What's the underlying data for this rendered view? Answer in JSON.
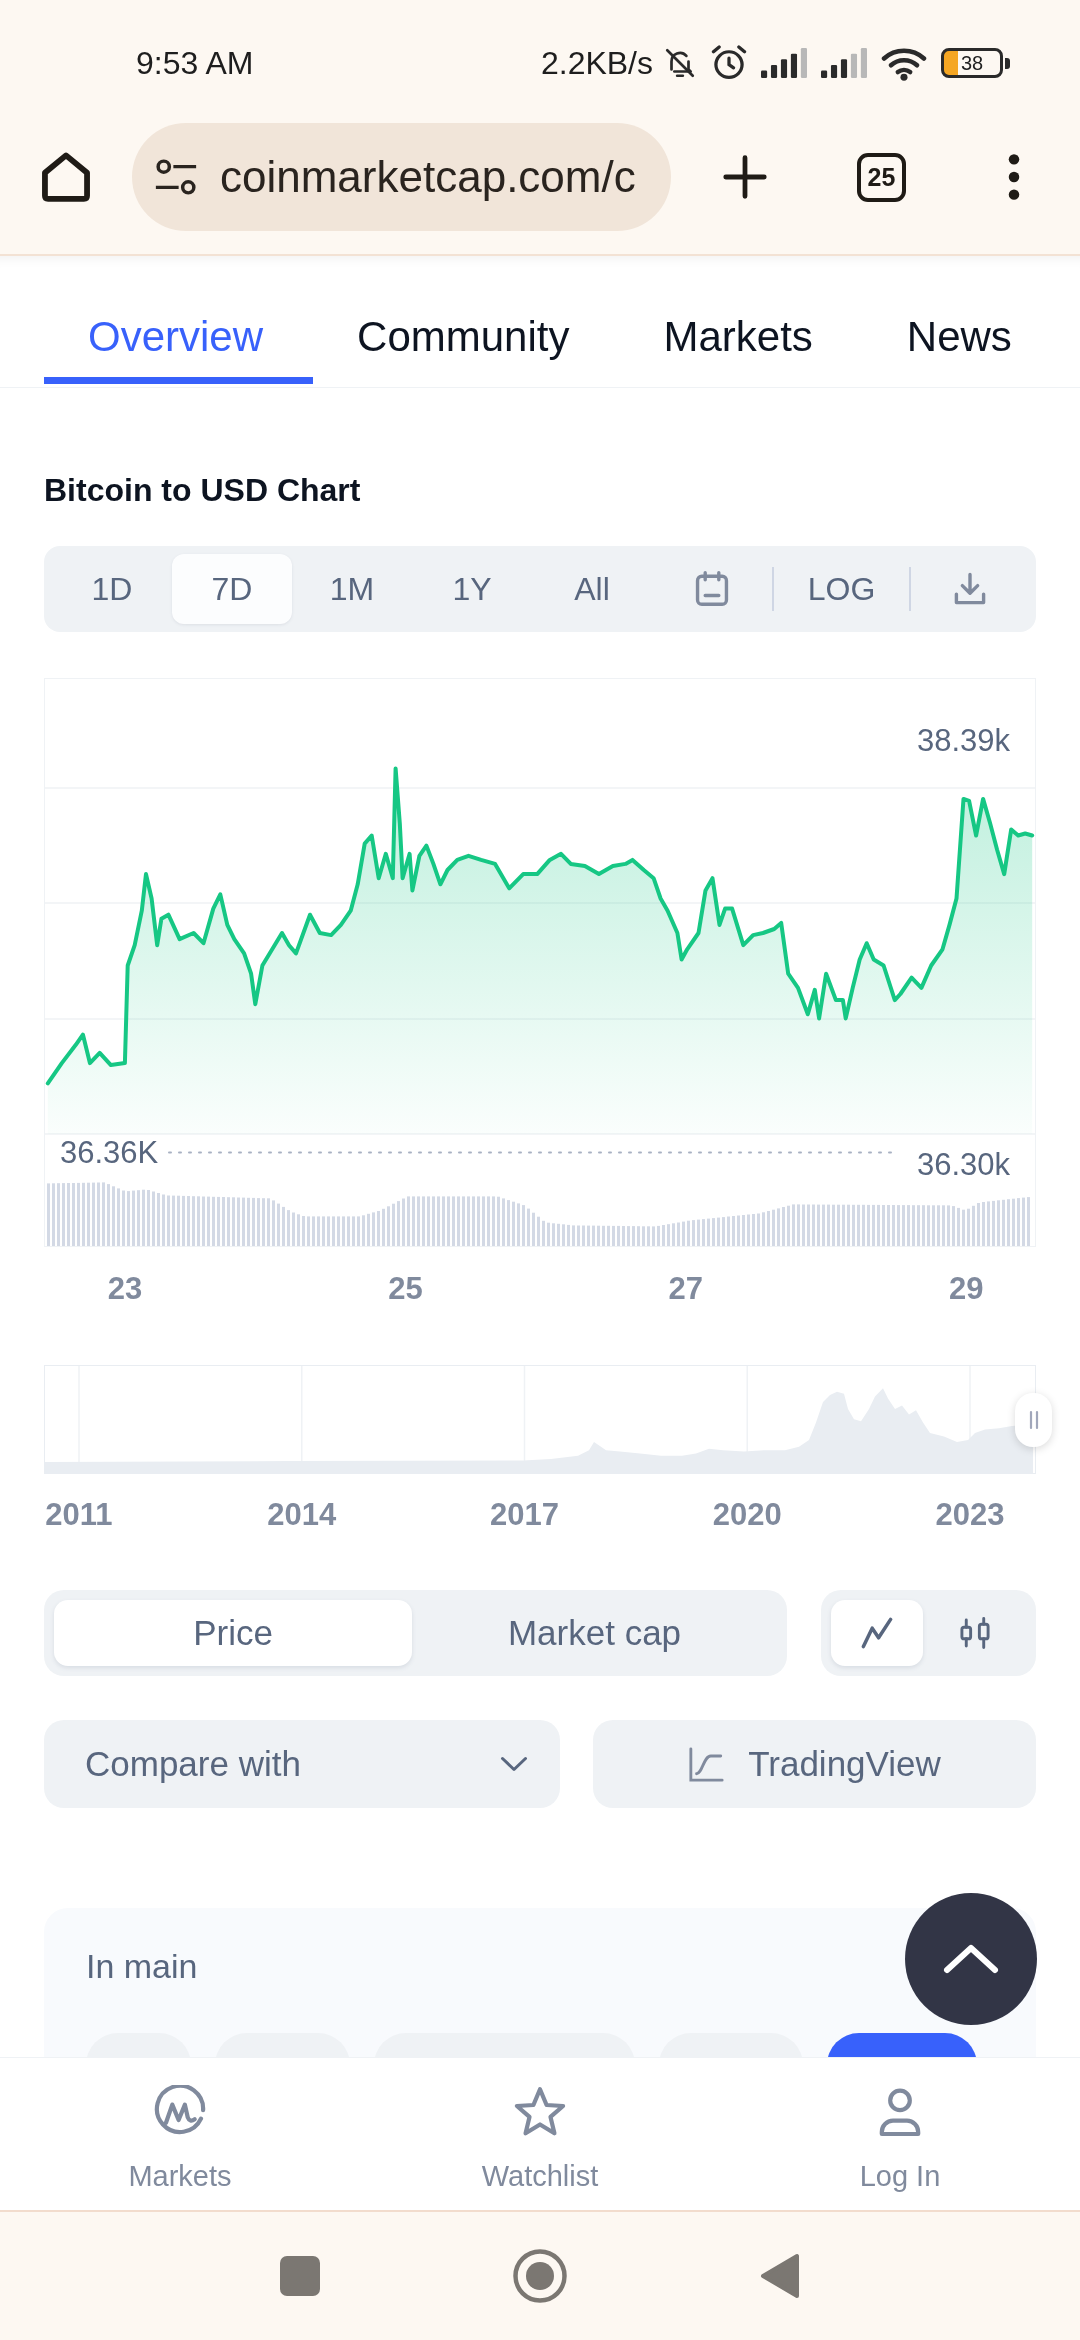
{
  "status_bar": {
    "time": "9:53 AM",
    "network_speed": "2.2KB/s",
    "battery_text": "38"
  },
  "browser": {
    "url": "coinmarketcap.com/c",
    "tab_count": "25"
  },
  "tabs": [
    {
      "label": "Overview",
      "selected": true
    },
    {
      "label": "Community",
      "selected": false
    },
    {
      "label": "Markets",
      "selected": false
    },
    {
      "label": "News",
      "selected": false
    }
  ],
  "chart_section": {
    "title": "Bitcoin to USD Chart",
    "ranges": [
      {
        "label": "1D",
        "selected": false
      },
      {
        "label": "7D",
        "selected": true
      },
      {
        "label": "1M",
        "selected": false
      },
      {
        "label": "1Y",
        "selected": false
      },
      {
        "label": "All",
        "selected": false
      }
    ],
    "log_label": "LOG",
    "price_chart": {
      "chart_data": {
        "type": "area",
        "x": [
          22.45,
          22.55,
          22.65,
          22.7,
          22.75,
          22.82,
          22.9,
          23.0,
          23.02,
          23.07,
          23.12,
          23.15,
          23.19,
          23.23,
          23.26,
          23.31,
          23.39,
          23.49,
          23.56,
          23.63,
          23.68,
          23.73,
          23.78,
          23.85,
          23.9,
          23.93,
          23.98,
          24.05,
          24.12,
          24.17,
          24.22,
          24.32,
          24.39,
          24.47,
          24.54,
          24.61,
          24.66,
          24.71,
          24.76,
          24.81,
          24.86,
          24.91,
          24.93,
          24.96,
          24.98,
          25.03,
          25.05,
          25.1,
          25.15,
          25.2,
          25.25,
          25.3,
          25.37,
          25.45,
          25.54,
          25.64,
          25.74,
          25.84,
          25.94,
          26.03,
          26.11,
          26.18,
          26.28,
          26.38,
          26.48,
          26.57,
          26.62,
          26.7,
          26.77,
          26.82,
          26.87,
          26.94,
          26.97,
          27.01,
          27.09,
          27.14,
          27.19,
          27.24,
          27.28,
          27.33,
          27.41,
          27.48,
          27.55,
          27.63,
          27.68,
          27.73,
          27.8,
          27.87,
          27.92,
          27.95,
          28.0,
          28.07,
          28.12,
          28.14,
          28.19,
          28.24,
          28.29,
          28.34,
          28.41,
          28.49,
          28.53,
          28.61,
          28.68,
          28.75,
          28.83,
          28.88,
          28.93,
          28.98,
          29.02,
          29.07,
          29.12,
          29.17,
          29.22,
          29.27,
          29.32,
          29.37,
          29.42,
          29.47
        ],
        "series": [
          {
            "color": "#16c784",
            "values": [
              36.7,
              36.8,
              36.89,
              36.94,
              36.8,
              36.85,
              36.79,
              36.8,
              37.28,
              37.38,
              37.55,
              37.73,
              37.61,
              37.38,
              37.51,
              37.53,
              37.41,
              37.44,
              37.39,
              37.56,
              37.63,
              37.48,
              37.41,
              37.34,
              37.24,
              37.09,
              37.28,
              37.36,
              37.44,
              37.38,
              37.34,
              37.53,
              37.44,
              37.43,
              37.48,
              37.55,
              37.68,
              37.88,
              37.92,
              37.71,
              37.83,
              37.71,
              38.25,
              37.98,
              37.71,
              37.83,
              37.65,
              37.82,
              37.87,
              37.78,
              37.68,
              37.75,
              37.8,
              37.82,
              37.8,
              37.78,
              37.66,
              37.73,
              37.73,
              37.8,
              37.83,
              37.78,
              37.77,
              37.73,
              37.77,
              37.78,
              37.8,
              37.75,
              37.71,
              37.61,
              37.55,
              37.44,
              37.31,
              37.36,
              37.44,
              37.65,
              37.71,
              37.48,
              37.56,
              37.56,
              37.38,
              37.43,
              37.44,
              37.46,
              37.49,
              37.24,
              37.17,
              37.04,
              37.16,
              37.02,
              37.24,
              37.11,
              37.11,
              37.02,
              37.17,
              37.31,
              37.39,
              37.31,
              37.28,
              37.11,
              37.14,
              37.22,
              37.17,
              37.28,
              37.36,
              37.48,
              37.61,
              38.1,
              38.09,
              37.92,
              38.1,
              37.98,
              37.85,
              37.73,
              37.95,
              37.92,
              37.93,
              37.92
            ]
          }
        ],
        "xlim": [
          22.43,
          29.49
        ],
        "ylim": [
          35.9,
          38.69
        ],
        "xticks": [
          {
            "value": 23,
            "label": "23"
          },
          {
            "value": 25,
            "label": "25"
          },
          {
            "value": 27,
            "label": "27"
          },
          {
            "value": 29,
            "label": "29"
          }
        ],
        "yticks": [
          {
            "value": 38.39,
            "label": "38.39k"
          },
          {
            "value": 36.3,
            "label": "36.30k"
          }
        ],
        "ref_lines": [
          {
            "axis": "y",
            "value": 36.36,
            "label": "36.36K"
          }
        ]
      }
    },
    "history_navigator": {
      "year_labels": [
        "2011",
        "2014",
        "2017",
        "2020",
        "2023"
      ]
    },
    "metric_toggle": [
      {
        "label": "Price",
        "selected": true
      },
      {
        "label": "Market cap",
        "selected": false
      }
    ],
    "chart_type_toggle": [
      {
        "kind": "line",
        "selected": true
      },
      {
        "kind": "candles",
        "selected": false
      }
    ],
    "compare": {
      "label": "Compare with"
    },
    "trading_view": {
      "label": "TradingView"
    }
  },
  "in_main": {
    "title": "In main",
    "chips": [
      {
        "selected": false
      },
      {
        "selected": false
      },
      {
        "selected": false
      },
      {
        "selected": false
      },
      {
        "selected": true
      }
    ]
  },
  "bottom_nav": [
    {
      "kind": "markets",
      "label": "Markets"
    },
    {
      "kind": "watchlist",
      "label": "Watchlist"
    },
    {
      "kind": "login",
      "label": "Log In"
    }
  ]
}
